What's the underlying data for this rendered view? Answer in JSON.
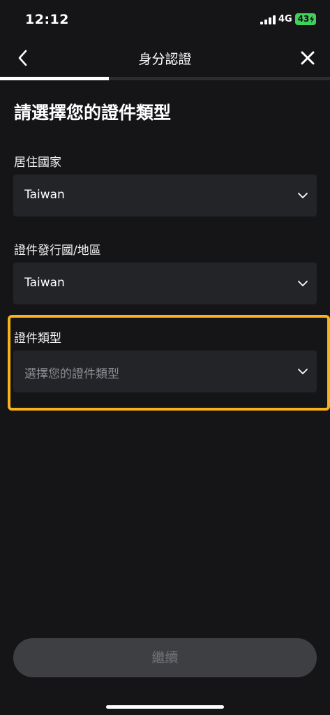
{
  "status_bar": {
    "time": "12:12",
    "network": "4G",
    "battery": "43",
    "battery_color": "#3fd15c"
  },
  "nav": {
    "title": "身分認證",
    "back_icon": "chevron-left-icon",
    "close_icon": "close-icon"
  },
  "progress": {
    "fraction": 0.33
  },
  "page_title": "請選擇您的證件類型",
  "fields": [
    {
      "label": "居住國家",
      "value": "Taiwan"
    },
    {
      "label": "證件發行國/地區",
      "value": "Taiwan"
    },
    {
      "label": "證件類型",
      "value": "",
      "placeholder": "選擇您的證件類型"
    }
  ],
  "highlight_color": "#f7b21c",
  "continue_button": {
    "label": "繼續",
    "enabled": false
  }
}
